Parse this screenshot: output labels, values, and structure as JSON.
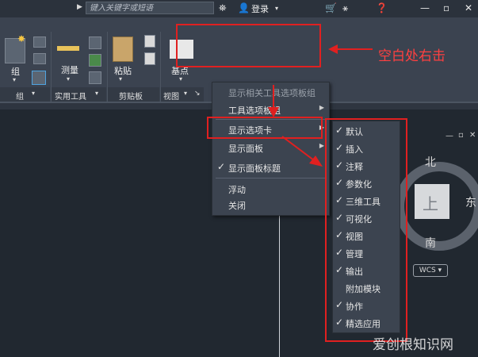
{
  "topbar": {
    "search_placeholder": "键入关键字或短语",
    "login": "登录"
  },
  "ribbon": {
    "big_buttons": {
      "group": "组",
      "measure": "测量",
      "paste": "粘贴",
      "base_point": "基点"
    },
    "panels": {
      "group": "组",
      "utilities": "实用工具",
      "clipboard": "剪贴板",
      "view": "视图"
    }
  },
  "annotation": {
    "right_click_hint": "空白处右击"
  },
  "context_menu": {
    "items": [
      {
        "label": "显示相关工具选项板组",
        "disabled": true,
        "checked": false,
        "submenu": false
      },
      {
        "label": "工具选项板组",
        "disabled": false,
        "checked": false,
        "submenu": true
      },
      {
        "label": "显示选项卡",
        "disabled": false,
        "checked": false,
        "submenu": true
      },
      {
        "label": "显示面板",
        "disabled": false,
        "checked": false,
        "submenu": true
      },
      {
        "label": "显示面板标题",
        "disabled": false,
        "checked": true,
        "submenu": false
      },
      {
        "label": "浮动",
        "disabled": false,
        "checked": false,
        "submenu": false
      },
      {
        "label": "关闭",
        "disabled": false,
        "checked": false,
        "submenu": false
      }
    ]
  },
  "tabs_submenu": {
    "items": [
      {
        "label": "默认",
        "checked": true
      },
      {
        "label": "插入",
        "checked": true
      },
      {
        "label": "注释",
        "checked": true
      },
      {
        "label": "参数化",
        "checked": true
      },
      {
        "label": "三维工具",
        "checked": true
      },
      {
        "label": "可视化",
        "checked": true
      },
      {
        "label": "视图",
        "checked": true
      },
      {
        "label": "管理",
        "checked": true
      },
      {
        "label": "输出",
        "checked": true
      },
      {
        "label": "附加模块",
        "checked": false
      },
      {
        "label": "协作",
        "checked": true
      },
      {
        "label": "精选应用",
        "checked": true
      }
    ]
  },
  "viewcube": {
    "top_face": "上",
    "north": "北",
    "south": "南",
    "east": "东",
    "wcs": "WCS"
  },
  "watermark": "爱创根知识网",
  "icons": {
    "check": "✓",
    "submenu_arrow": "▶",
    "dropdown": "▾"
  }
}
